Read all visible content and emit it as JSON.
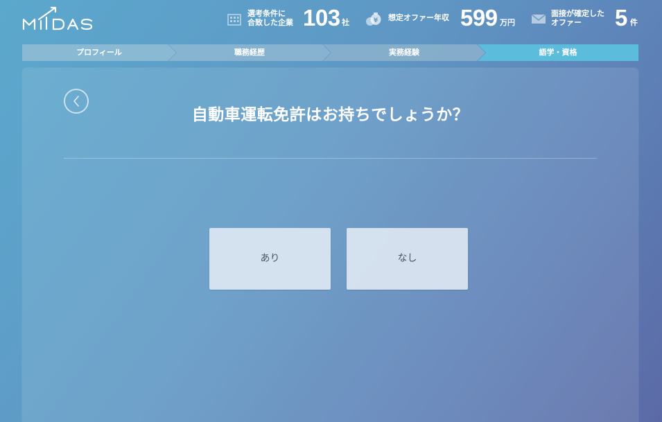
{
  "header": {
    "logo_text": "MIIDAS",
    "stats": [
      {
        "icon": "building-icon",
        "label_line1": "選考条件に",
        "label_line2": "合致した企業",
        "value": "103",
        "unit": "社"
      },
      {
        "icon": "money-bag-icon",
        "label_line1": "想定オファー年収",
        "label_line2": "",
        "value": "599",
        "unit": "万円"
      },
      {
        "icon": "mail-icon",
        "label_line1": "面接が確定した",
        "label_line2": "オファー",
        "value": "5",
        "unit": "件"
      }
    ]
  },
  "steps": [
    {
      "label": "プロフィール",
      "active": false
    },
    {
      "label": "職務経歴",
      "active": false
    },
    {
      "label": "実務経験",
      "active": false
    },
    {
      "label": "語学・資格",
      "active": true
    }
  ],
  "colors": {
    "step_inactive": "#8fbcd4",
    "step_active": "#5bbcdc",
    "option_bg": "#e2eaf4",
    "option_text": "#4a5566"
  },
  "question": {
    "text": "自動車運転免許はお持ちでしょうか？"
  },
  "options": [
    {
      "label": "あり"
    },
    {
      "label": "なし"
    }
  ]
}
